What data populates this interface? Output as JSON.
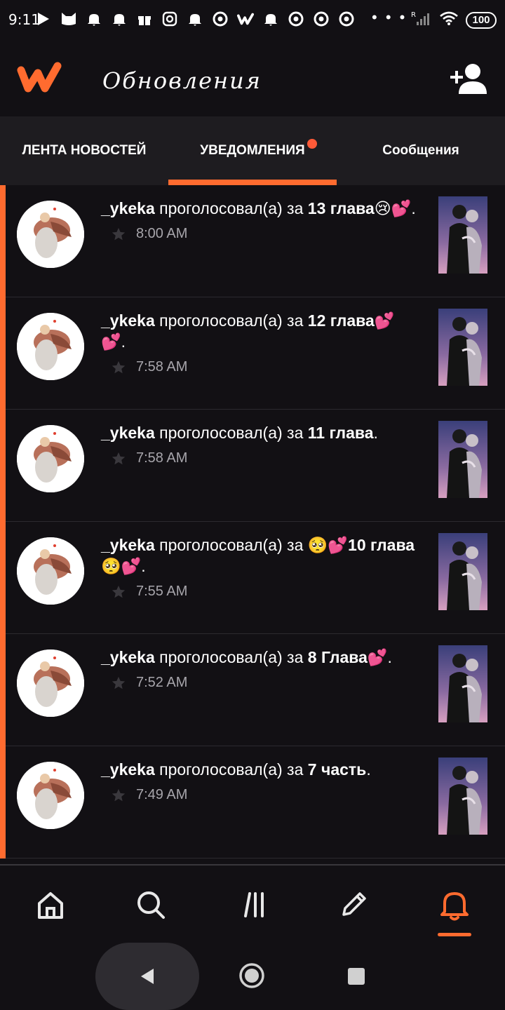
{
  "status_bar": {
    "time": "9:11",
    "battery": "100",
    "notification_icons": [
      "play-store-icon",
      "cat-app-icon",
      "alarm-icon",
      "alarm-icon",
      "gift-icon",
      "instagram-icon",
      "alarm-icon",
      "chrome-icon",
      "wattpad-icon",
      "alarm-icon",
      "chrome-icon",
      "chrome-icon",
      "chrome-icon"
    ],
    "overflow": "• • •"
  },
  "header": {
    "title": "Обновления"
  },
  "tabs": [
    {
      "label": "ЛЕНТА НОВОСТЕЙ"
    },
    {
      "label": "УВЕДОМЛЕНИЯ",
      "active": true,
      "has_badge": true
    },
    {
      "label": "Сообщения"
    }
  ],
  "notifications": [
    {
      "user": "_ykeka",
      "action": " проголосовал(а) за ",
      "target": "13 глава😢💕",
      "end": ".",
      "time": "8:00 AM"
    },
    {
      "user": "_ykeka",
      "action": " проголосовал(а) за ",
      "target": "12 глава💕💕",
      "end": ".",
      "time": "7:58 AM"
    },
    {
      "user": "_ykeka",
      "action": " проголосовал(а) за ",
      "target": "11 глава",
      "end": ".",
      "time": "7:58 AM"
    },
    {
      "user": "_ykeka",
      "action": " проголосовал(а) за ",
      "target": "🥺💕10 глава🥺💕",
      "end": ".",
      "time": "7:55 AM"
    },
    {
      "user": "_ykeka",
      "action": " проголосовал(а) за ",
      "target": "8 Глава💕",
      "end": ".",
      "time": "7:52 AM"
    },
    {
      "user": "_ykeka",
      "action": " проголосовал(а) за ",
      "target": "7 часть",
      "end": ".",
      "time": "7:49 AM"
    }
  ],
  "colors": {
    "accent": "#ff6b2f",
    "background": "#121014",
    "tab_bar": "#1e1c20",
    "muted_text": "#a7a5ab"
  },
  "bottom_nav": [
    "home-icon",
    "search-icon",
    "library-icon",
    "write-icon",
    "notifications-icon"
  ]
}
